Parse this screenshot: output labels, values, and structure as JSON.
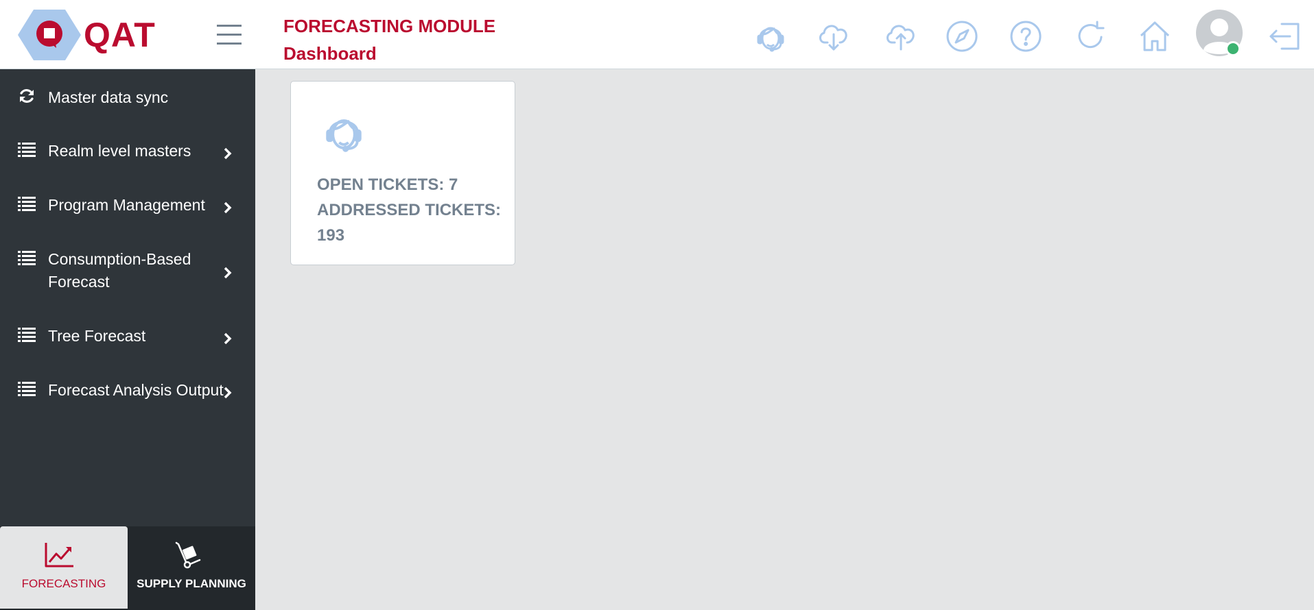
{
  "app": {
    "logo_text": "QAT"
  },
  "header": {
    "module_title": "FORECASTING MODULE",
    "page_title": "Dashboard",
    "icons": [
      "support-agent-icon",
      "cloud-download-icon",
      "cloud-upload-icon",
      "compass-icon",
      "help-icon",
      "refresh-icon",
      "home-icon",
      "avatar",
      "logout-icon"
    ],
    "online_status_color": "#3cb371"
  },
  "sidebar": {
    "items": [
      {
        "label": "Master data sync",
        "icon": "sync-icon",
        "has_submenu": false
      },
      {
        "label": "Realm level masters",
        "icon": "list-icon",
        "has_submenu": true
      },
      {
        "label": "Program Management",
        "icon": "list-icon",
        "has_submenu": true
      },
      {
        "label_line1": "Consumption-Based",
        "label_line2": "Forecast",
        "icon": "list-icon",
        "has_submenu": true
      },
      {
        "label": "Tree Forecast",
        "icon": "list-icon",
        "has_submenu": true
      },
      {
        "label": "Forecast Analysis Output",
        "icon": "list-icon",
        "has_submenu": true
      }
    ]
  },
  "bottom_tabs": [
    {
      "label": "FORECASTING",
      "icon": "trend-chart-icon",
      "active": true
    },
    {
      "label": "SUPPLY PLANNING",
      "icon": "hand-truck-icon",
      "active": false
    }
  ],
  "tickets_card": {
    "open_line": "OPEN TICKETS: 7",
    "addressed_line1": "ADDRESSED TICKETS:",
    "addressed_line2": "193"
  },
  "colors": {
    "brand_red": "#ba0c2f",
    "sidebar_bg": "#2f353a",
    "icon_blue": "#a9c8ec",
    "main_bg": "#e4e5e6"
  }
}
